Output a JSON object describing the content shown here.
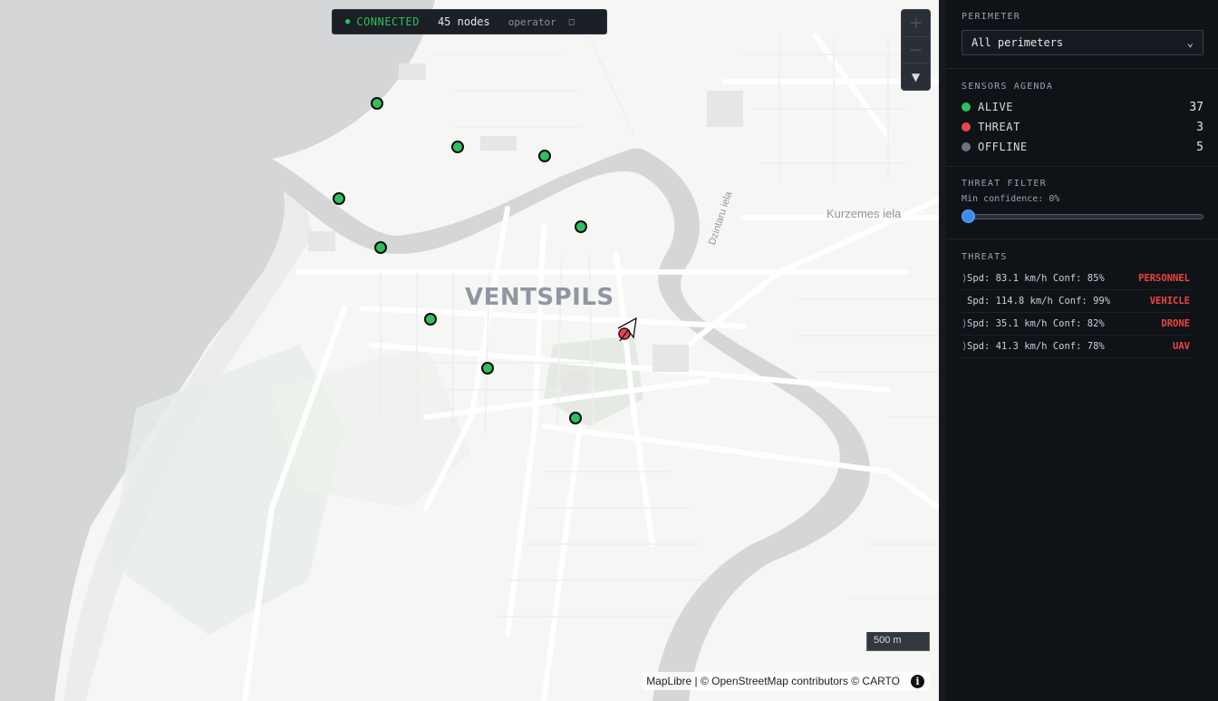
{
  "status": {
    "dot": "●",
    "connection": "CONNECTED",
    "nodes": "45 nodes",
    "user": "operator",
    "logout_icon": "□"
  },
  "map": {
    "city_label": "VENTSPILS",
    "street_1": "Kurzemes iela",
    "street_2": "Dzintaru iela",
    "scale": "500 m",
    "attribution": "MapLibre | © OpenStreetMap contributors © CARTO",
    "info_icon": "i",
    "zoom_in": "+",
    "zoom_out": "−",
    "compass": "▼",
    "sensor_color": "#2fbf5d",
    "threat_color": "#e5484d"
  },
  "sidebar": {
    "perimeter": {
      "title": "PERIMETER",
      "selected": "All perimeters"
    },
    "agenda": {
      "title": "SENSORS AGENDA",
      "items": [
        {
          "label": "ALIVE",
          "count": "37",
          "color": "#2fbf5d"
        },
        {
          "label": "THREAT",
          "count": "3",
          "color": "#e5484d"
        },
        {
          "label": "OFFLINE",
          "count": "5",
          "color": "#6b7280"
        }
      ]
    },
    "filter": {
      "title": "THREAT FILTER",
      "label": "Min confidence: 0%",
      "value": 0
    },
    "threats": {
      "title": "THREATS",
      "items": [
        {
          "arrow": "⟩",
          "text": "Spd: 83.1 km/h Conf: 85%",
          "class": "PERSONNEL"
        },
        {
          "arrow": "",
          "text": "Spd: 114.8 km/h Conf: 99%",
          "class": "VEHICLE"
        },
        {
          "arrow": "⟩",
          "text": "Spd: 35.1 km/h Conf: 82%",
          "class": "DRONE"
        },
        {
          "arrow": "⟩",
          "text": "Spd: 41.3 km/h Conf: 78%",
          "class": "UAV"
        }
      ],
      "class_color": "#f0443e"
    }
  }
}
